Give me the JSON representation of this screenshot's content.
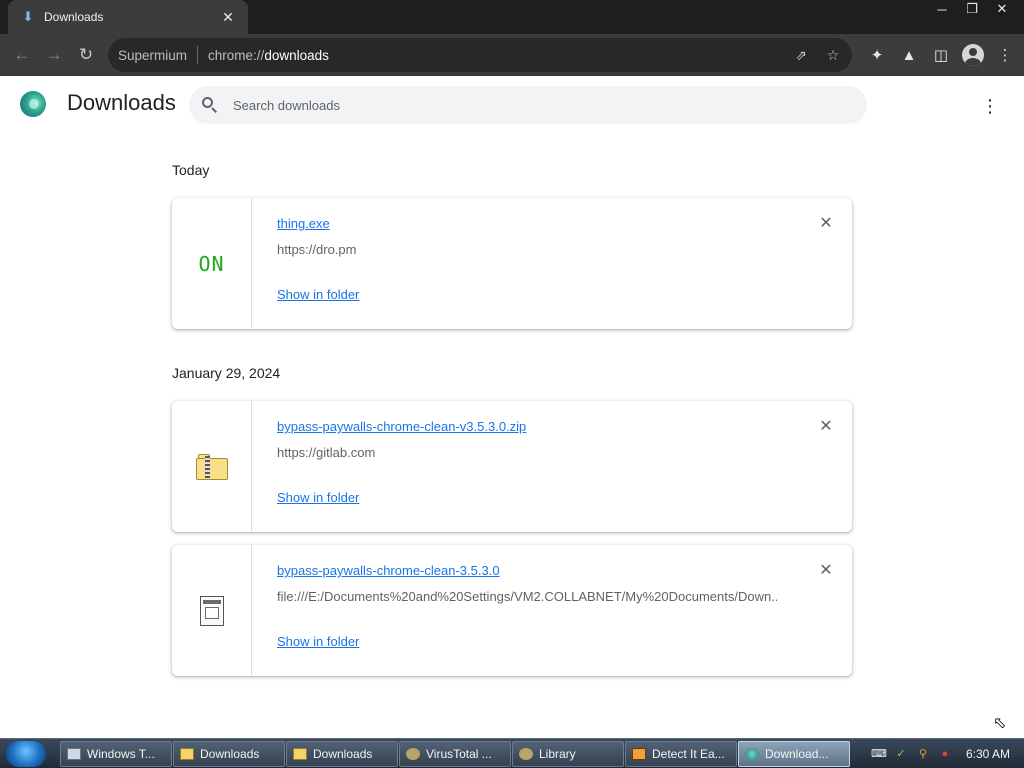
{
  "window": {
    "tab_title": "Downloads",
    "tab_favicon": "download-icon",
    "controls": [
      "minimize-icon",
      "restore-icon",
      "close-icon"
    ]
  },
  "toolbar": {
    "omnibox_site": "Supermium",
    "url_prefix": "chrome://",
    "url_path": "downloads",
    "icons": [
      "back-icon",
      "forward-icon",
      "reload-icon",
      "share-icon",
      "star-icon",
      "extensions-icon",
      "labs-icon",
      "side-panel-icon",
      "profile-icon",
      "menu-icon"
    ]
  },
  "header": {
    "title": "Downloads",
    "search_placeholder": "Search downloads"
  },
  "groups": [
    {
      "date": "Today",
      "items": [
        {
          "file": "thing.exe",
          "url": "https://dro.pm",
          "action": "Show in folder",
          "icon": "on-icon"
        }
      ]
    },
    {
      "date": "January 29, 2024",
      "items": [
        {
          "file": "bypass-paywalls-chrome-clean-v3.5.3.0.zip",
          "url": "https://gitlab.com",
          "action": "Show in folder",
          "icon": "zip-folder-icon"
        },
        {
          "file": "bypass-paywalls-chrome-clean-3.5.3.0",
          "url": "file:///E:/Documents%20and%20Settings/VM2.COLLABNET/My%20Documents/Down...",
          "action": "Show in folder",
          "icon": "file-icon"
        }
      ]
    }
  ],
  "icon_text": {
    "on": "ON"
  },
  "taskbar": {
    "items": [
      {
        "label": "Windows T...",
        "icon": "computer-icon"
      },
      {
        "label": "Downloads",
        "icon": "folder-icon"
      },
      {
        "label": "Downloads",
        "icon": "folder-icon"
      },
      {
        "label": "VirusTotal ...",
        "icon": "bug-icon"
      },
      {
        "label": "Library",
        "icon": "bug-icon"
      },
      {
        "label": "Detect It Ea...",
        "icon": "die-icon"
      },
      {
        "label": "Download...",
        "icon": "supermium-icon"
      }
    ],
    "active_index": 6,
    "clock": "6:30 AM"
  },
  "colors": {
    "link": "#1a73e8",
    "chrome_dark": "#3c3c3c",
    "on_icon": "#1faa1f"
  }
}
